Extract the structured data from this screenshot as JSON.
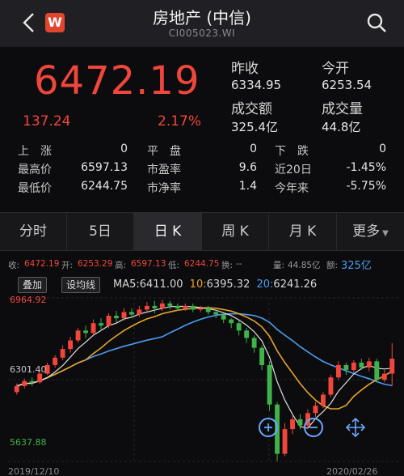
{
  "header": {
    "title": "房地产 (中信)",
    "code": "CI005023.WI",
    "logo_text": "W"
  },
  "quote": {
    "price": "6472.19",
    "change": "137.24",
    "change_pct": "2.17%",
    "prev_close_label": "昨收",
    "prev_close": "6334.95",
    "open_label": "今开",
    "open": "6253.54",
    "turnover_label": "成交额",
    "turnover": "325.4亿",
    "volume_label": "成交量",
    "volume": "44.8亿"
  },
  "stats": {
    "rows": [
      [
        {
          "label": "上　涨",
          "value": "0"
        },
        {
          "label": "平　盘",
          "value": "0"
        },
        {
          "label": "下　跌",
          "value": "0"
        }
      ],
      [
        {
          "label": "最高价",
          "value": "6597.13"
        },
        {
          "label": "市盈率",
          "value": "9.6"
        },
        {
          "label": "近20日",
          "value": "-1.45%"
        }
      ],
      [
        {
          "label": "最低价",
          "value": "6244.75"
        },
        {
          "label": "市净率",
          "value": "1.4"
        },
        {
          "label": "今年来",
          "value": "-5.75%"
        }
      ]
    ]
  },
  "tabs": [
    "分时",
    "5日",
    "日 K",
    "周 K",
    "月 K",
    "更多"
  ],
  "active_tab": 2,
  "info": {
    "close_label": "收:",
    "close": "6472.19",
    "open_label": "开:",
    "open": "6253.29",
    "high_label": "高:",
    "high": "6597.13",
    "low_label": "低:",
    "low": "6244.75",
    "change_label": "换:",
    "change": "--",
    "vol_label": "量:",
    "vol": "44.85亿",
    "amount_label": "额:",
    "amount": "325亿"
  },
  "chart_controls": {
    "overlay": "叠加",
    "set_ma": "设均线",
    "ma_label": "MA",
    "ma5_label": "5:",
    "ma5": "6411.00",
    "ma10_label": "10:",
    "ma10": "6395.32",
    "ma20_label": "20:",
    "ma20": "6241.26"
  },
  "colors": {
    "up": "#f0463b",
    "down": "#3fb24a",
    "ma5": "#f0f0f0",
    "ma10": "#e6a52a",
    "ma20": "#4b9cf0",
    "accent": "#4b9cf0"
  },
  "chart_data": {
    "type": "candlestick",
    "y_max": "6964.92",
    "y_mid": "6301.40",
    "y_min": "5637.88",
    "x_start": "2019/12/10",
    "x_end": "2020/02/26",
    "candles": [
      [
        6200,
        6250,
        6180,
        6270
      ],
      [
        6250,
        6290,
        6230,
        6310
      ],
      [
        6290,
        6280,
        6250,
        6320
      ],
      [
        6280,
        6350,
        6270,
        6370
      ],
      [
        6350,
        6420,
        6340,
        6440
      ],
      [
        6420,
        6480,
        6400,
        6500
      ],
      [
        6480,
        6550,
        6460,
        6580
      ],
      [
        6550,
        6620,
        6520,
        6650
      ],
      [
        6620,
        6700,
        6600,
        6720
      ],
      [
        6700,
        6680,
        6640,
        6740
      ],
      [
        6680,
        6760,
        6660,
        6790
      ],
      [
        6760,
        6740,
        6700,
        6800
      ],
      [
        6740,
        6820,
        6720,
        6840
      ],
      [
        6820,
        6800,
        6760,
        6860
      ],
      [
        6800,
        6850,
        6780,
        6880
      ],
      [
        6850,
        6830,
        6800,
        6880
      ],
      [
        6830,
        6870,
        6810,
        6900
      ],
      [
        6870,
        6900,
        6850,
        6930
      ],
      [
        6900,
        6880,
        6840,
        6940
      ],
      [
        6880,
        6920,
        6860,
        6950
      ],
      [
        6920,
        6900,
        6870,
        6940
      ],
      [
        6900,
        6880,
        6860,
        6920
      ],
      [
        6880,
        6900,
        6860,
        6920
      ],
      [
        6900,
        6870,
        6850,
        6920
      ],
      [
        6870,
        6880,
        6850,
        6900
      ],
      [
        6880,
        6850,
        6830,
        6900
      ],
      [
        6850,
        6830,
        6800,
        6870
      ],
      [
        6830,
        6790,
        6760,
        6840
      ],
      [
        6790,
        6760,
        6720,
        6800
      ],
      [
        6760,
        6700,
        6660,
        6780
      ],
      [
        6700,
        6640,
        6600,
        6720
      ],
      [
        6640,
        6560,
        6520,
        6660
      ],
      [
        6560,
        6420,
        6380,
        6580
      ],
      [
        6420,
        6100,
        6050,
        6450
      ],
      [
        6100,
        5700,
        5640,
        6120
      ],
      [
        5700,
        5900,
        5680,
        5950
      ],
      [
        5900,
        5980,
        5860,
        6020
      ],
      [
        5980,
        5930,
        5900,
        6020
      ],
      [
        5930,
        6030,
        5910,
        6060
      ],
      [
        6030,
        6090,
        6000,
        6120
      ],
      [
        6090,
        6180,
        6070,
        6200
      ],
      [
        6180,
        6320,
        6160,
        6340
      ],
      [
        6320,
        6420,
        6300,
        6450
      ],
      [
        6420,
        6380,
        6340,
        6440
      ],
      [
        6380,
        6440,
        6360,
        6460
      ],
      [
        6440,
        6400,
        6380,
        6470
      ],
      [
        6400,
        6450,
        6370,
        6480
      ],
      [
        6450,
        6300,
        6280,
        6470
      ],
      [
        6300,
        6350,
        6280,
        6380
      ],
      [
        6350,
        6472,
        6250,
        6597
      ]
    ]
  }
}
